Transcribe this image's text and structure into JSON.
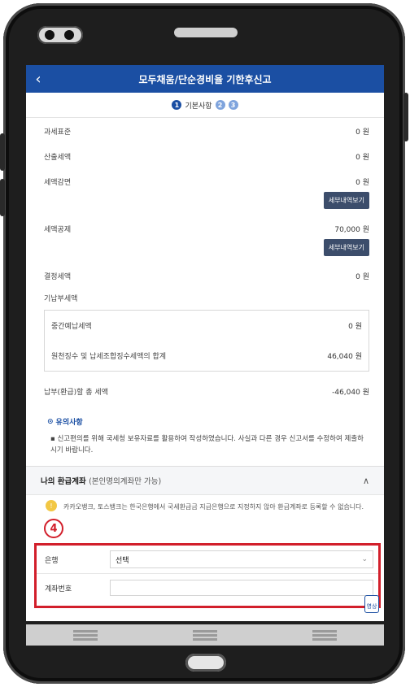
{
  "app": {
    "title": "모두채움/단순경비율 기한후신고",
    "back_icon": "chevron-left-icon"
  },
  "steps": {
    "current_number": "1",
    "current_label": "기본사항",
    "step2": "2",
    "step3": "3"
  },
  "rows": {
    "tax_base": {
      "label": "과세표준",
      "value": "0 원"
    },
    "calculated_tax": {
      "label": "산출세액",
      "value": "0 원"
    },
    "tax_reduction": {
      "label": "세액감면",
      "value": "0 원",
      "button": "세부내역보기"
    },
    "tax_credit": {
      "label": "세액공제",
      "value": "70,000 원",
      "button": "세부내역보기"
    },
    "determined_tax": {
      "label": "결정세액",
      "value": "0 원"
    },
    "prepaid_tax_heading": "기납부세액",
    "interim_prepaid": {
      "label": "중간예납세액",
      "value": "0 원"
    },
    "withholding_total": {
      "label": "원천징수 및 납세조합징수세액의 합계",
      "value": "46,040 원"
    },
    "total_payable": {
      "label": "납부(환급)할 총 세액",
      "value": "-46,040 원"
    }
  },
  "notice": {
    "heading": "유의사항",
    "body": "신고편의를 위해 국세청 보유자료를 활용하여 작성하였습니다. 사실과 다른 경우 신고서를 수정하여 제출하시기 바랍니다."
  },
  "refund_account": {
    "title": "나의 환급계좌",
    "subtitle": "(본인명의계좌만 가능)",
    "collapse_icon": "chevron-up-icon",
    "kakao_notice": "카카오뱅크, 토스뱅크는 한국은행에서 국세환급금 지급은행으로 지정하지 않아 환급계좌로 등록할 수 없습니다.",
    "annotation_number": "4",
    "bank_label": "은행",
    "bank_value": "선택",
    "account_label": "계좌번호",
    "account_value": "",
    "video_chip": "영상"
  },
  "colors": {
    "primary": "#1b4fa3",
    "highlight_red": "#d21f2b",
    "detail_button": "#3c4d6b"
  }
}
